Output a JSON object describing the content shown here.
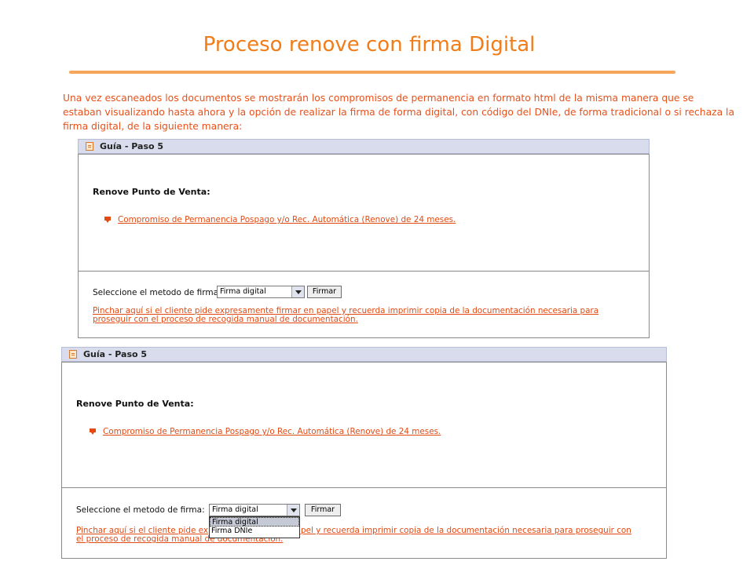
{
  "page": {
    "title": "Proceso renove con firma Digital",
    "intro": "Una vez escaneados los documentos se mostrarán los compromisos de permanencia en formato html de la misma manera que se estaban visualizando hasta ahora y la opción de realizar la firma de forma digital, con código del DNIe, de forma tradicional o si rechaza la firma digital, de la siguiente manera:"
  },
  "panels": [
    {
      "header": "Guía - Paso 5",
      "section_label": "Renove Punto de Venta:",
      "document_link": "Compromiso de Permanencia Pospago y/o Rec. Automática (Renove) de 24 meses.",
      "method_label": "Seleccione el metodo de firma:",
      "selected_method": "Firma digital",
      "sign_button": "Firmar",
      "paper_note": "Pinchar aquí si el cliente pide expresamente firmar en papel y recuerda imprimir copia de la documentación necesaria para proseguir con el proceso de recogida manual de documentación."
    },
    {
      "header": "Guía - Paso 5",
      "section_label": "Renove Punto de Venta:",
      "document_link": "Compromiso de Permanencia Pospago y/o Rec. Automática (Renove) de 24 meses.",
      "method_label": "Seleccione el metodo de firma:",
      "selected_method": "Firma digital",
      "sign_button": "Firmar",
      "paper_note_line1_start": "Pinchar aquí si el cliente pide ex",
      "paper_note_line1_end": "papel y recuerda imprimir copia de la documentación necesaria para proseguir con",
      "paper_note_line2": "el proceso de recogida manual de documentación.",
      "dropdown_options": [
        "Firma digital",
        "Firma DNIe"
      ]
    }
  ],
  "colors": {
    "title": "#f07d1a",
    "intro_text": "#e8501a",
    "link": "#e24a12",
    "header_bg": "#d9dced"
  },
  "icons": {
    "header_icon": "guide-document-icon",
    "bullet_icon": "document-bullet-icon",
    "dropdown_icon": "chevron-down-icon"
  }
}
